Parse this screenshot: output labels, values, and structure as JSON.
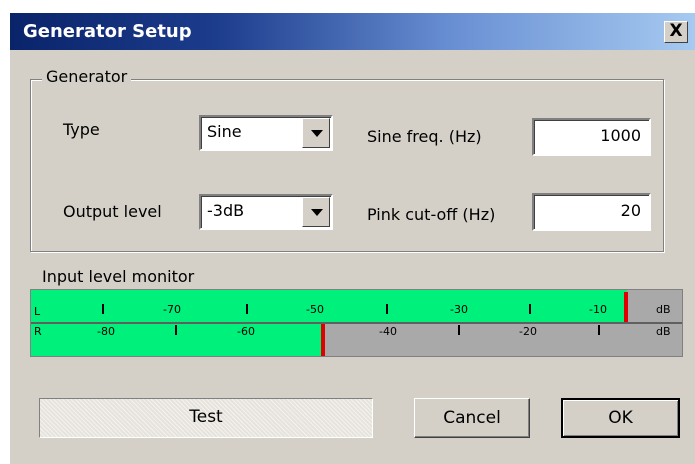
{
  "window": {
    "title": "Generator Setup",
    "close_label": "X"
  },
  "generator": {
    "group_label": "Generator",
    "type_label": "Type",
    "type_value": "Sine",
    "output_level_label": "Output level",
    "output_level_value": "-3dB",
    "sine_freq_label": "Sine freq. (Hz)",
    "sine_freq_value": "1000",
    "pink_cutoff_label": "Pink cut-off (Hz)",
    "pink_cutoff_value": "20"
  },
  "monitor": {
    "label": "Input level monitor",
    "unit": "dB",
    "left": {
      "channel": "L",
      "level_fraction": 0.915,
      "scale": [
        "-70",
        "-50",
        "-30",
        "-10"
      ]
    },
    "right": {
      "channel": "R",
      "level_fraction": 0.45,
      "scale": [
        "-80",
        "-60",
        "-40",
        "-20"
      ]
    },
    "colors": {
      "fill": "#00f07c",
      "peak": "#e00000",
      "empty": "#a9a9a9"
    }
  },
  "buttons": {
    "test": "Test",
    "cancel": "Cancel",
    "ok": "OK"
  }
}
